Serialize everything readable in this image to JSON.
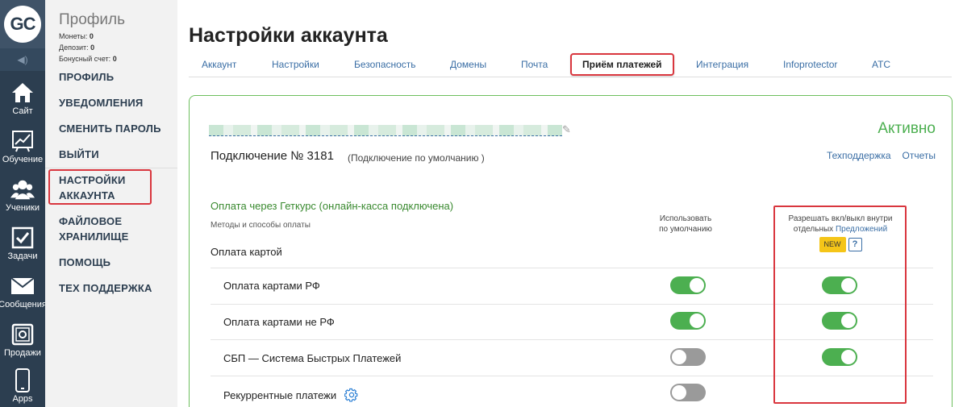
{
  "rail": {
    "logo": "GC",
    "items": [
      {
        "label": "Сайт",
        "icon": "house-icon"
      },
      {
        "label": "Обучение",
        "icon": "chart-icon"
      },
      {
        "label": "Ученики",
        "icon": "users-icon"
      },
      {
        "label": "Задачи",
        "icon": "checkbox-icon"
      },
      {
        "label": "Сообщения",
        "icon": "envelope-icon"
      },
      {
        "label": "Продажи",
        "icon": "safe-icon"
      },
      {
        "label": "Apps",
        "icon": "phone-icon"
      }
    ]
  },
  "profile": {
    "title": "Профиль",
    "coins_label": "Монеты:",
    "coins": "0",
    "deposit_label": "Депозит:",
    "deposit": "0",
    "bonus_label": "Бонусный счет:",
    "bonus": "0"
  },
  "side_menu": {
    "profile": "ПРОФИЛЬ",
    "notifications": "УВЕДОМЛЕНИЯ",
    "change_password": "СМЕНИТЬ ПАРОЛЬ",
    "logout": "ВЫЙТИ",
    "account_settings_1": "НАСТРОЙКИ",
    "account_settings_2": "АККАУНТА",
    "file_storage_1": "ФАЙЛОВОЕ",
    "file_storage_2": "ХРАНИЛИЩЕ",
    "help": "ПОМОЩЬ",
    "tech_support": "ТЕХ ПОДДЕРЖКА"
  },
  "page": {
    "title": "Настройки аккаунта",
    "tabs": [
      "Аккаунт",
      "Настройки",
      "Безопасность",
      "Домены",
      "Почта",
      "Приём платежей",
      "Интеграция",
      "Infoprotector",
      "АТС"
    ],
    "active_tab": "Приём платежей"
  },
  "panel": {
    "status": "Активно",
    "connection": "Подключение № 3181",
    "connection_note": "(Подключение по умолчанию )",
    "support_link": "Техподдержка",
    "reports_link": "Отчеты",
    "payment_title": "Оплата через Геткурс (онлайн-касса подключена)",
    "methods_label": "Методы и способы оплаты",
    "card_header": "Оплата картой",
    "col_default_1": "Использовать",
    "col_default_2": "по умолчанию",
    "col_allow_1": "Разрешать вкл/выкл внутри",
    "col_allow_2": "отдельных",
    "col_allow_link": "Предложений",
    "new_badge": "NEW",
    "help_button": "?",
    "rows": [
      {
        "label": "Оплата картами РФ",
        "default_on": true,
        "allow_on": true
      },
      {
        "label": "Оплата картами не РФ",
        "default_on": true,
        "allow_on": true
      },
      {
        "label": "СБП — Система Быстрых Платежей",
        "default_on": false,
        "allow_on": true
      },
      {
        "label": "Рекуррентные платежи",
        "default_on": false,
        "allow_on": null
      }
    ]
  },
  "colors": {
    "rail": "#2c3e50",
    "accent_green": "#4caf50",
    "highlight_red": "#d9363e",
    "link_blue": "#3a6ea5"
  }
}
